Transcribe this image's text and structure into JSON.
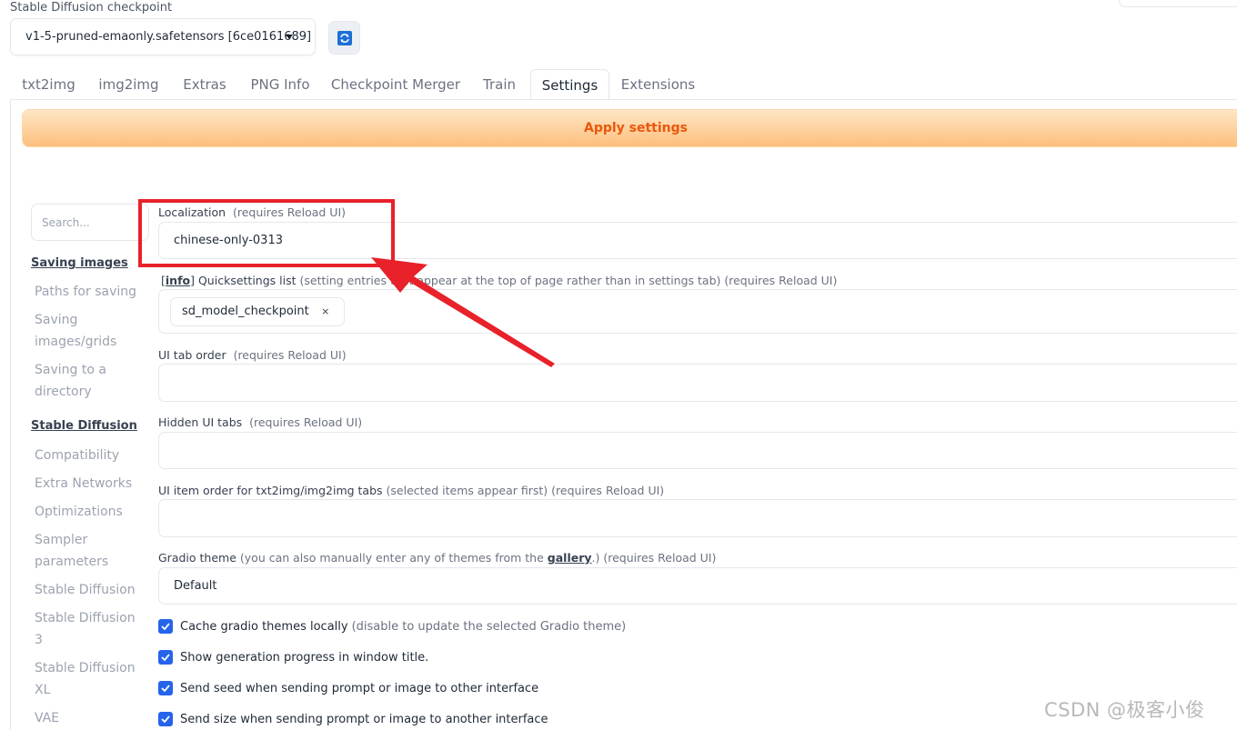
{
  "checkpoint": {
    "label": "Stable Diffusion checkpoint",
    "value": "v1-5-pruned-emaonly.safetensors [6ce0161689]"
  },
  "tabs": [
    {
      "label": "txt2img"
    },
    {
      "label": "img2img"
    },
    {
      "label": "Extras"
    },
    {
      "label": "PNG Info"
    },
    {
      "label": "Checkpoint Merger"
    },
    {
      "label": "Train"
    },
    {
      "label": "Settings"
    },
    {
      "label": "Extensions"
    }
  ],
  "apply_label": "Apply settings",
  "search": {
    "placeholder": "Search..."
  },
  "sidebar": {
    "groups": [
      {
        "label": "Saving images"
      },
      {
        "label": "Stable Diffusion"
      }
    ],
    "items": [
      {
        "label": "Paths for saving"
      },
      {
        "label": "Saving images/grids"
      },
      {
        "label": "Saving to a directory"
      },
      {
        "label": "Compatibility"
      },
      {
        "label": "Extra Networks"
      },
      {
        "label": "Optimizations"
      },
      {
        "label": "Sampler parameters"
      },
      {
        "label": "Stable Diffusion"
      },
      {
        "label": "Stable Diffusion 3"
      },
      {
        "label": "Stable Diffusion XL"
      },
      {
        "label": "VAE"
      }
    ]
  },
  "settings": {
    "localization": {
      "label": "Localization",
      "hint": "(requires Reload UI)",
      "value": "chinese-only-0313"
    },
    "quicksettings": {
      "info_link": "info",
      "label": "Quicksettings list",
      "hint": "(setting entries that appear at the top of page rather than in settings tab) (requires Reload UI)",
      "chip": "sd_model_checkpoint",
      "chip_remove": "×"
    },
    "tab_order": {
      "label": "UI tab order",
      "hint": "(requires Reload UI)"
    },
    "hidden_tabs": {
      "label": "Hidden UI tabs",
      "hint": "(requires Reload UI)"
    },
    "item_order": {
      "label": "UI item order for txt2img/img2img tabs",
      "hint": "(selected items appear first) (requires Reload UI)"
    },
    "gradio_theme": {
      "label": "Gradio theme",
      "hint_pre": "(you can also manually enter any of themes from the",
      "link": "gallery",
      "hint_post": ".) (requires Reload UI)",
      "value": "Default"
    },
    "checkboxes": [
      {
        "label": "Cache gradio themes locally",
        "hint": "(disable to update the selected Gradio theme)",
        "checked": true
      },
      {
        "label": "Show generation progress in window title.",
        "hint": "",
        "checked": true
      },
      {
        "label": "Send seed when sending prompt or image to other interface",
        "hint": "",
        "checked": true
      },
      {
        "label": "Send size when sending prompt or image to another interface",
        "hint": "",
        "checked": true
      }
    ]
  },
  "annotation": {
    "color": "#e8212a"
  },
  "watermark": "CSDN @极客小俊"
}
